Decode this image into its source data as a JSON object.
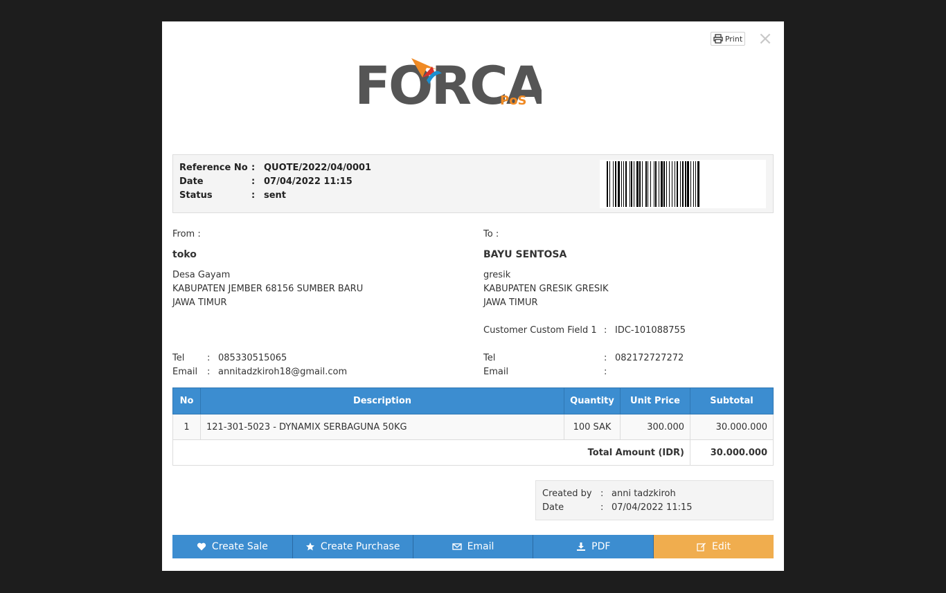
{
  "toolbar": {
    "print_label": "Print"
  },
  "logo": {
    "text": "FORCA",
    "sub": "PoS"
  },
  "reference": {
    "rows": [
      {
        "label": "Reference No",
        "value": "QUOTE/2022/04/0001"
      },
      {
        "label": "Date",
        "value": "07/04/2022 11:15"
      },
      {
        "label": "Status",
        "value": "sent"
      }
    ]
  },
  "from": {
    "label": "From :",
    "name": "toko",
    "address": [
      "Desa Gayam",
      "KABUPATEN JEMBER 68156 SUMBER BARU",
      "JAWA TIMUR"
    ],
    "tel_label": "Tel",
    "tel": "085330515065",
    "email_label": "Email",
    "email": "annitadzkiroh18@gmail.com"
  },
  "to": {
    "label": "To :",
    "name": "BAYU SENTOSA",
    "address": [
      "gresik",
      "KABUPATEN GRESIK GRESIK",
      "JAWA TIMUR"
    ],
    "custom_label": "Customer Custom Field 1",
    "custom_value": "IDC-101088755",
    "tel_label": "Tel",
    "tel": "082172727272",
    "email_label": "Email",
    "email": ""
  },
  "items": {
    "headers": [
      "No",
      "Description",
      "Quantity",
      "Unit Price",
      "Subtotal"
    ],
    "rows": [
      {
        "no": "1",
        "description": "121-301-5023 - DYNAMIX SERBAGUNA 50KG",
        "quantity": "100 SAK",
        "unit_price": "300.000",
        "subtotal": "30.000.000"
      }
    ],
    "total_label": "Total Amount (IDR)",
    "total_value": "30.000.000"
  },
  "created": {
    "by_label": "Created by",
    "by": "anni tadzkiroh",
    "date_label": "Date",
    "date": "07/04/2022 11:15"
  },
  "actions": {
    "create_sale": "Create Sale",
    "create_purchase": "Create Purchase",
    "email": "Email",
    "pdf": "PDF",
    "edit": "Edit"
  },
  "colors": {
    "primary": "#3c8dd0",
    "warning": "#f0ad4e",
    "logo_orange": "#f08a24",
    "logo_blue": "#1a8fd0",
    "logo_red": "#d9302b"
  }
}
